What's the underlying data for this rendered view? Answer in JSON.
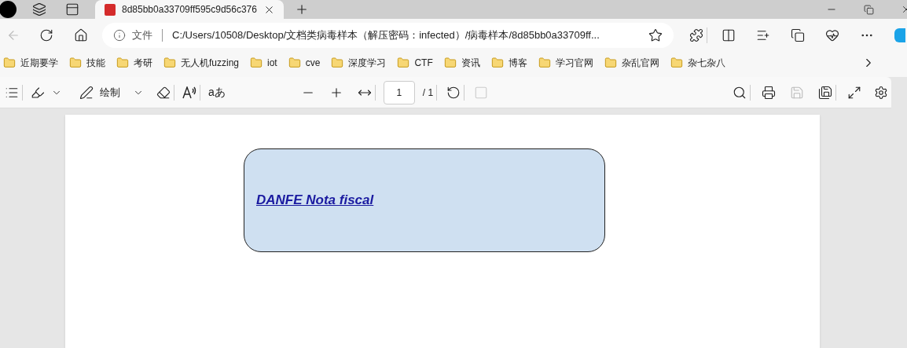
{
  "tab": {
    "title": "8d85bb0a33709ff595c9d56c376",
    "selected": true
  },
  "address": {
    "scheme_label": "文件",
    "url": "C:/Users/10508/Desktop/文档类病毒样本（解压密码：infected）/病毒样本/8d85bb0a33709ff..."
  },
  "bookmarks": [
    "近期要学",
    "技能",
    "考研",
    "无人机fuzzing",
    "iot",
    "cve",
    "深度学习",
    "CTF",
    "资讯",
    "博客",
    "学习官网",
    "杂乱官网",
    "杂七杂八"
  ],
  "pdf_toolbar": {
    "draw_label": "绘制",
    "text_option": "aあ",
    "page_number": "1",
    "page_total": "/ 1"
  },
  "document": {
    "link_text": "DANFE Nota fiscal"
  }
}
